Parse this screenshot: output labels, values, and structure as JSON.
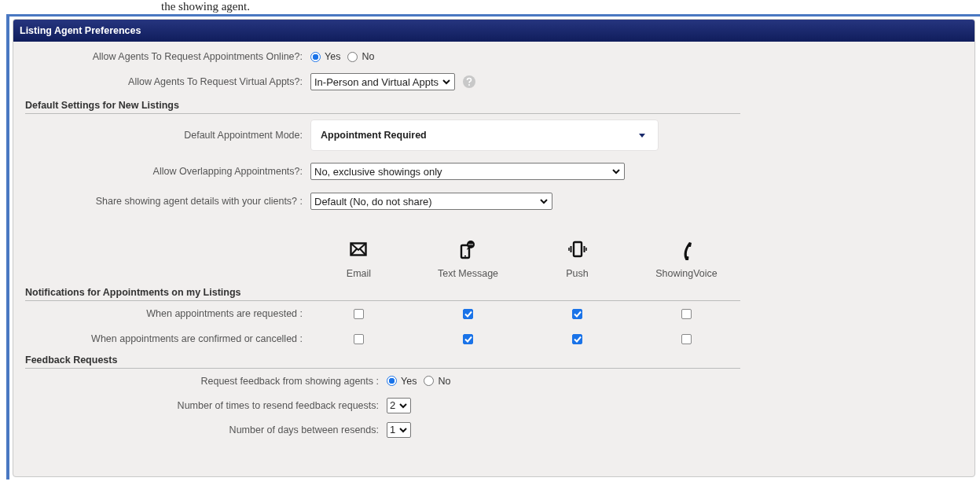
{
  "page_caption": "the showing agent.",
  "panel": {
    "title": "Listing Agent Preferences"
  },
  "top_settings": [
    {
      "kind": "radio",
      "label": "Allow Agents To Request Appointments Online?:",
      "options": [
        {
          "label": "Yes",
          "selected": true
        },
        {
          "label": "No",
          "selected": false
        }
      ]
    },
    {
      "kind": "select",
      "label": "Allow Agents To Request Virtual Appts?:",
      "value": "In-Person and Virtual Appts",
      "help": true
    }
  ],
  "default_settings": {
    "title": "Default Settings for New Listings",
    "settings": [
      {
        "kind": "wide",
        "label": "Default Appointment Mode:",
        "value": "Appointment Required"
      },
      {
        "kind": "select",
        "label": "Allow Overlapping Appointments?:",
        "value": "No, exclusive showings only"
      },
      {
        "kind": "select",
        "label": "Share showing agent details with your clients? :",
        "value": "Default (No, do not share)"
      }
    ]
  },
  "channels": [
    {
      "kind": "envelope",
      "label": "Email"
    },
    {
      "kind": "sms",
      "label": "Text Message"
    },
    {
      "kind": "vibrate",
      "label": "Push"
    },
    {
      "kind": "phone",
      "label": "ShowingVoice"
    }
  ],
  "notifications": {
    "title": "Notifications for Appointments on my Listings",
    "rows": [
      {
        "label": "When appointments are requested :",
        "checks": [
          false,
          true,
          true,
          false
        ]
      },
      {
        "label": "When appointments are confirmed or cancelled :",
        "checks": [
          false,
          true,
          true,
          false
        ]
      }
    ]
  },
  "feedback": {
    "title": "Feedback Requests",
    "settings": [
      {
        "kind": "radio",
        "label": "Request feedback from showing agents :",
        "options": [
          {
            "label": "Yes",
            "selected": true
          },
          {
            "label": "No",
            "selected": false
          }
        ]
      },
      {
        "kind": "select",
        "label": "Number of times to resend feedback requests:",
        "value": "2"
      },
      {
        "kind": "select",
        "label": "Number of days between resends:",
        "value": "1"
      }
    ]
  }
}
